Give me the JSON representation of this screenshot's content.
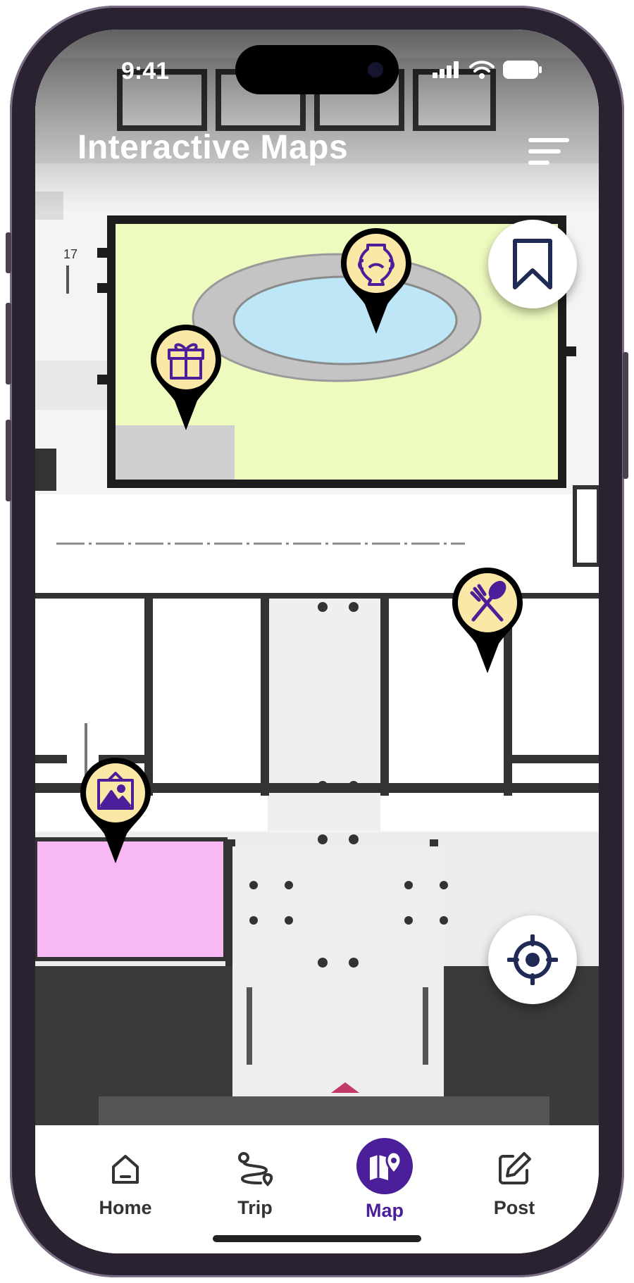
{
  "status_bar": {
    "time": "9:41"
  },
  "header": {
    "title": "Interactive Maps",
    "menu_icon": "hamburger-menu-icon"
  },
  "map": {
    "pins": [
      {
        "category": "museum",
        "icon": "vase-icon"
      },
      {
        "category": "gift-shop",
        "icon": "gift-icon"
      },
      {
        "category": "restaurant",
        "icon": "fork-spoon-icon"
      },
      {
        "category": "gallery",
        "icon": "picture-icon"
      }
    ],
    "bookmark_icon": "bookmark-icon",
    "locate_icon": "crosshair-icon"
  },
  "tab_bar": {
    "items": [
      {
        "label": "Home",
        "icon": "home-icon",
        "active": false
      },
      {
        "label": "Trip",
        "icon": "route-icon",
        "active": false
      },
      {
        "label": "Map",
        "icon": "map-pin-icon",
        "active": true
      },
      {
        "label": "Post",
        "icon": "edit-icon",
        "active": false
      }
    ]
  },
  "colors": {
    "accent": "#4b1f9a",
    "pin_fill": "#fbe7a6",
    "courtyard": "#eefbbf",
    "pool": "#bde6f6",
    "gallery_room": "#f8b8f3"
  }
}
